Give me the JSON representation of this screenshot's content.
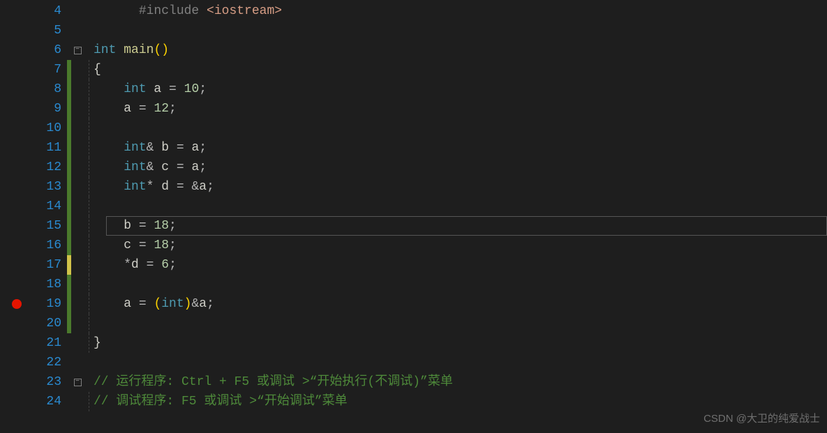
{
  "watermark": "CSDN @大卫的纯爱战士",
  "current_line_index": 11,
  "breakpoint_lines": [
    19
  ],
  "lines": [
    {
      "num": 4,
      "diff": "",
      "fold": "",
      "guides": 0,
      "tokens": [
        {
          "t": "      ",
          "c": ""
        },
        {
          "t": "#include",
          "c": "preproc"
        },
        {
          "t": " ",
          "c": ""
        },
        {
          "t": "<iostream>",
          "c": "include-lit"
        }
      ]
    },
    {
      "num": 5,
      "diff": "",
      "fold": "",
      "guides": 0,
      "tokens": []
    },
    {
      "num": 6,
      "diff": "",
      "fold": "box",
      "guides": 0,
      "tokens": [
        {
          "t": "int",
          "c": "keyword"
        },
        {
          "t": " ",
          "c": ""
        },
        {
          "t": "main",
          "c": "func"
        },
        {
          "t": "()",
          "c": "paren"
        }
      ]
    },
    {
      "num": 7,
      "diff": "green",
      "fold": "",
      "guides": 1,
      "tokens": [
        {
          "t": "{",
          "c": "brace"
        }
      ]
    },
    {
      "num": 8,
      "diff": "green",
      "fold": "",
      "guides": 1,
      "tokens": [
        {
          "t": "    ",
          "c": ""
        },
        {
          "t": "int",
          "c": "keyword"
        },
        {
          "t": " a ",
          "c": "ident"
        },
        {
          "t": "=",
          "c": "op"
        },
        {
          "t": " ",
          "c": ""
        },
        {
          "t": "10",
          "c": "num"
        },
        {
          "t": ";",
          "c": "op"
        }
      ]
    },
    {
      "num": 9,
      "diff": "green",
      "fold": "",
      "guides": 1,
      "tokens": [
        {
          "t": "    a ",
          "c": "ident"
        },
        {
          "t": "=",
          "c": "op"
        },
        {
          "t": " ",
          "c": ""
        },
        {
          "t": "12",
          "c": "num"
        },
        {
          "t": ";",
          "c": "op"
        }
      ]
    },
    {
      "num": 10,
      "diff": "green",
      "fold": "",
      "guides": 1,
      "tokens": []
    },
    {
      "num": 11,
      "diff": "green",
      "fold": "",
      "guides": 1,
      "tokens": [
        {
          "t": "    ",
          "c": ""
        },
        {
          "t": "int",
          "c": "keyword"
        },
        {
          "t": "&",
          "c": "op"
        },
        {
          "t": " b ",
          "c": "ident"
        },
        {
          "t": "=",
          "c": "op"
        },
        {
          "t": " a",
          "c": "ident"
        },
        {
          "t": ";",
          "c": "op"
        }
      ]
    },
    {
      "num": 12,
      "diff": "green",
      "fold": "",
      "guides": 1,
      "tokens": [
        {
          "t": "    ",
          "c": ""
        },
        {
          "t": "int",
          "c": "keyword"
        },
        {
          "t": "&",
          "c": "op"
        },
        {
          "t": " c ",
          "c": "ident"
        },
        {
          "t": "=",
          "c": "op"
        },
        {
          "t": " a",
          "c": "ident"
        },
        {
          "t": ";",
          "c": "op"
        }
      ]
    },
    {
      "num": 13,
      "diff": "green",
      "fold": "",
      "guides": 1,
      "tokens": [
        {
          "t": "    ",
          "c": ""
        },
        {
          "t": "int",
          "c": "keyword"
        },
        {
          "t": "*",
          "c": "op"
        },
        {
          "t": " d ",
          "c": "ident"
        },
        {
          "t": "=",
          "c": "op"
        },
        {
          "t": " ",
          "c": ""
        },
        {
          "t": "&",
          "c": "op"
        },
        {
          "t": "a",
          "c": "ident"
        },
        {
          "t": ";",
          "c": "op"
        }
      ]
    },
    {
      "num": 14,
      "diff": "green",
      "fold": "",
      "guides": 1,
      "tokens": []
    },
    {
      "num": 15,
      "diff": "green",
      "fold": "",
      "guides": 1,
      "tokens": [
        {
          "t": "    b ",
          "c": "ident"
        },
        {
          "t": "=",
          "c": "op"
        },
        {
          "t": " ",
          "c": ""
        },
        {
          "t": "18",
          "c": "num"
        },
        {
          "t": ";",
          "c": "op"
        }
      ]
    },
    {
      "num": 16,
      "diff": "green",
      "fold": "",
      "guides": 1,
      "tokens": [
        {
          "t": "    c ",
          "c": "ident"
        },
        {
          "t": "=",
          "c": "op"
        },
        {
          "t": " ",
          "c": ""
        },
        {
          "t": "18",
          "c": "num"
        },
        {
          "t": ";",
          "c": "op"
        }
      ]
    },
    {
      "num": 17,
      "diff": "yellow",
      "fold": "",
      "guides": 1,
      "tokens": [
        {
          "t": "    ",
          "c": ""
        },
        {
          "t": "*",
          "c": "op"
        },
        {
          "t": "d ",
          "c": "ident"
        },
        {
          "t": "=",
          "c": "op"
        },
        {
          "t": " ",
          "c": ""
        },
        {
          "t": "6",
          "c": "num"
        },
        {
          "t": ";",
          "c": "op"
        }
      ]
    },
    {
      "num": 18,
      "diff": "green",
      "fold": "",
      "guides": 1,
      "tokens": []
    },
    {
      "num": 19,
      "diff": "green",
      "fold": "",
      "guides": 1,
      "tokens": [
        {
          "t": "    a ",
          "c": "ident"
        },
        {
          "t": "=",
          "c": "op"
        },
        {
          "t": " ",
          "c": ""
        },
        {
          "t": "(",
          "c": "paren"
        },
        {
          "t": "int",
          "c": "keyword"
        },
        {
          "t": ")",
          "c": "paren"
        },
        {
          "t": "&",
          "c": "op"
        },
        {
          "t": "a",
          "c": "ident"
        },
        {
          "t": ";",
          "c": "op"
        }
      ]
    },
    {
      "num": 20,
      "diff": "green",
      "fold": "",
      "guides": 1,
      "tokens": []
    },
    {
      "num": 21,
      "diff": "",
      "fold": "",
      "guides": 1,
      "tokens": [
        {
          "t": "}",
          "c": "brace"
        }
      ]
    },
    {
      "num": 22,
      "diff": "",
      "fold": "",
      "guides": 0,
      "tokens": []
    },
    {
      "num": 23,
      "diff": "",
      "fold": "box",
      "guides": 0,
      "tokens": [
        {
          "t": "// 运行程序: Ctrl + F5 或调试 >“开始执行(不调试)”菜单",
          "c": "comment"
        }
      ]
    },
    {
      "num": 24,
      "diff": "",
      "fold": "",
      "guides": 1,
      "tokens": [
        {
          "t": "// 调试程序: F5 或调试 >“开始调试”菜单",
          "c": "comment"
        }
      ]
    }
  ]
}
